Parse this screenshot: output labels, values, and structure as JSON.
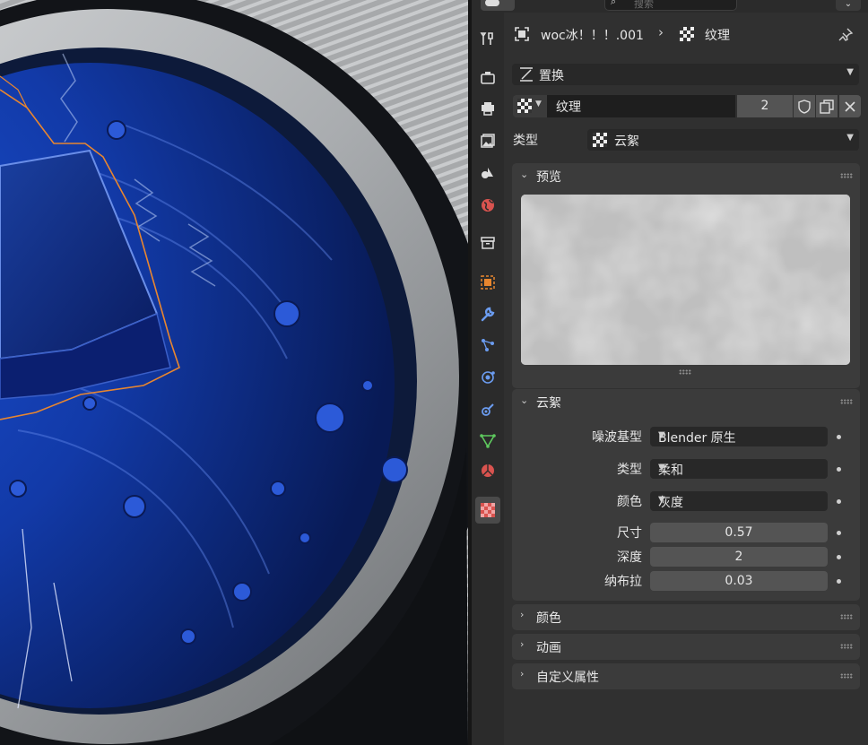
{
  "header": {
    "search_placeholder": "搜索",
    "menu_chevron": "⌄"
  },
  "tabs": [
    {
      "name": "tool-tab",
      "icon": "tool-icon"
    },
    {
      "name": "render-tab",
      "icon": "render-icon"
    },
    {
      "name": "output-tab",
      "icon": "printer-icon"
    },
    {
      "name": "view-layer-tab",
      "icon": "image-stack-icon"
    },
    {
      "name": "scene-tab",
      "icon": "scene-icon"
    },
    {
      "name": "world-tab",
      "icon": "world-icon"
    },
    {
      "name": "collection-tab",
      "icon": "box-icon"
    },
    {
      "name": "object-tab",
      "icon": "object-icon"
    },
    {
      "name": "modifier-tab",
      "icon": "wrench-icon"
    },
    {
      "name": "particles-tab",
      "icon": "particles-icon"
    },
    {
      "name": "physics-tab",
      "icon": "physics-icon"
    },
    {
      "name": "constraints-tab",
      "icon": "constraints-icon"
    },
    {
      "name": "data-tab",
      "icon": "mesh-data-icon"
    },
    {
      "name": "material-tab",
      "icon": "material-icon"
    },
    {
      "name": "texture-tab",
      "icon": "checker-icon",
      "active": true
    }
  ],
  "breadcrumb": {
    "object": "woc冰！！！.001",
    "separator": "›",
    "texture": "纹理"
  },
  "context": {
    "modifier_name": "置换"
  },
  "texture": {
    "name": "纹理",
    "users": "2"
  },
  "type_row": {
    "label": "类型",
    "value": "云絮"
  },
  "preview_panel": {
    "title": "预览",
    "chevron": "⌄"
  },
  "clouds_panel": {
    "title": "云絮",
    "chevron": "⌄",
    "noise_basis": {
      "label": "噪波基型",
      "value": "Blender 原生"
    },
    "noise_type": {
      "label": "类型",
      "value": "柔和"
    },
    "color": {
      "label": "颜色",
      "value": "灰度"
    },
    "size": {
      "label": "尺寸",
      "value": "0.57"
    },
    "depth": {
      "label": "深度",
      "value": "2"
    },
    "nabla": {
      "label": "纳布拉",
      "value": "0.03"
    }
  },
  "collapsed_panels": [
    {
      "title": "颜色",
      "chevron": "›"
    },
    {
      "title": "动画",
      "chevron": "›"
    },
    {
      "title": "自定义属性",
      "chevron": "›"
    }
  ],
  "colors": {
    "accent_orange": "#e8862f",
    "active_tab_bg": "#4a4a4a",
    "panel_bg": "#3b3b3b",
    "field_bg": "#545454",
    "dropdown_bg": "#282828"
  }
}
